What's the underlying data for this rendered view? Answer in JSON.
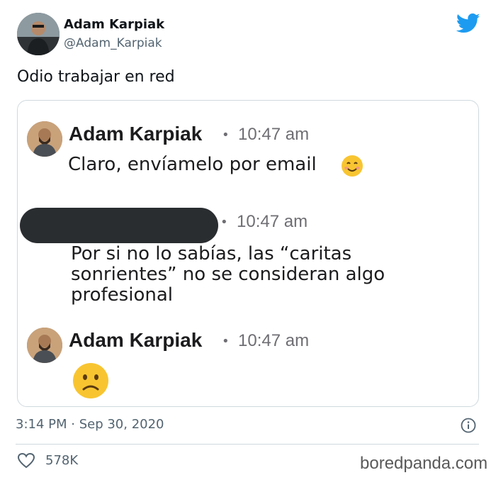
{
  "tweet": {
    "author_name": "Adam Karpiak",
    "author_handle": "@Adam_Karpiak",
    "text": "Odio trabajar en red",
    "timestamp": "3:14 PM · Sep 30, 2020",
    "likes": "578K",
    "logo_icon": "twitter-bird-icon",
    "logo_color": "#1d9bf0"
  },
  "embedded": {
    "messages": [
      {
        "name": "Adam Karpiak",
        "dot": "•",
        "time": "10:47 am",
        "text": "Claro, envíamelo por email",
        "emoji": "smile"
      },
      {
        "name_redacted": true,
        "dot": "•",
        "time": "10:47 am",
        "text_lines": [
          "Por si no lo sabías, las “caritas",
          "sonrientes” no se consideran algo",
          "profesional"
        ]
      },
      {
        "name": "Adam Karpiak",
        "dot": "•",
        "time": "10:47 am",
        "emoji": "frown"
      }
    ]
  },
  "watermark": "boredpanda.com"
}
